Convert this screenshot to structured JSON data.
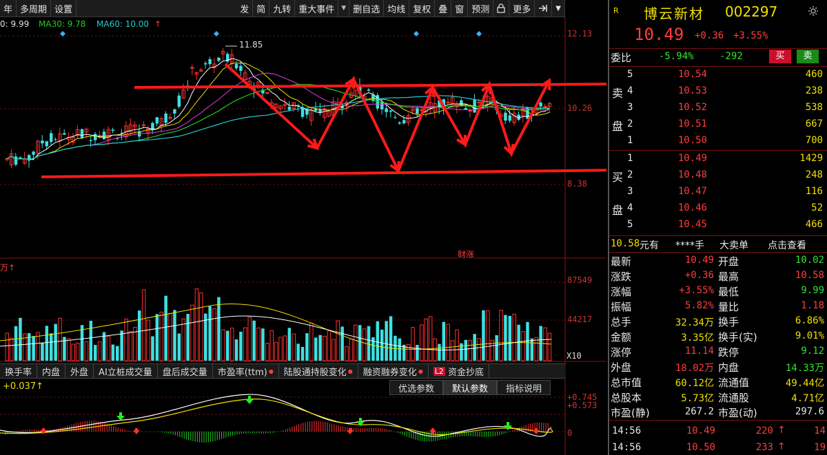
{
  "toolbar": {
    "left_items": [
      "年",
      "多周期",
      "设置"
    ],
    "right_items": [
      {
        "label": "发"
      },
      {
        "label": "简"
      },
      {
        "label": "九转"
      },
      {
        "label": "重大事件",
        "dropdown": true
      },
      {
        "label": "删自选"
      },
      {
        "label": "均线"
      },
      {
        "label": "复权"
      },
      {
        "label": "叠"
      },
      {
        "label": "窗"
      },
      {
        "label": "预测"
      },
      {
        "icon": "lock-icon"
      },
      {
        "label": "更多"
      },
      {
        "icon": "exit-icon"
      },
      {
        "icon": "chevron-down-icon"
      }
    ]
  },
  "legend": {
    "ma_a": "0: 9.99",
    "ma30": "MA30: 9.78",
    "ma60": "MA60: 10.00",
    "ma60_arrow": "↑",
    "vol_unit": "万↑",
    "macd_value": "+0.037↑",
    "colors": {
      "ma_a": "#e0e0e0",
      "ma30": "#22cc22",
      "ma60": "#22cccc"
    }
  },
  "price_axis": {
    "top": "12.13",
    "mid": "10.26",
    "low": "8.38"
  },
  "volume_axis": {
    "top": "87549",
    "mid": "44217",
    "unit": "X10"
  },
  "macd_axis": {
    "top": "+0.745",
    "mid": "+0.573",
    "zero": "0"
  },
  "annotations": {
    "high_label": "11.85",
    "caizhang": "财涨"
  },
  "indicator_tabs": [
    "换手率",
    "内盘",
    "外盘",
    "AI立桩成交量",
    "盘后成交量",
    "市盈率(ttm)",
    "陆股通持股变化",
    "融资融券变化",
    "资金抄底"
  ],
  "l2_badge": "L2",
  "param_tabs": [
    "优选参数",
    "默认参数",
    "指标说明"
  ],
  "stock": {
    "flag": "R",
    "name": "博云新材",
    "code": "002297",
    "price": "10.49",
    "change": "+0.36",
    "change_pct": "+3.55%"
  },
  "order_ratio": {
    "label": "委比",
    "pct": "-5.94%",
    "diff": "-292",
    "buy_btn": "买",
    "sell_btn": "卖"
  },
  "sell_label": [
    "卖",
    "盘"
  ],
  "buy_label": [
    "买",
    "盘"
  ],
  "sell_levels": [
    {
      "level": "5",
      "price": "10.54",
      "vol": "460"
    },
    {
      "level": "4",
      "price": "10.53",
      "vol": "238"
    },
    {
      "level": "3",
      "price": "10.52",
      "vol": "538"
    },
    {
      "level": "2",
      "price": "10.51",
      "vol": "667"
    },
    {
      "level": "1",
      "price": "10.50",
      "vol": "700"
    }
  ],
  "buy_levels": [
    {
      "level": "1",
      "price": "10.49",
      "vol": "1429"
    },
    {
      "level": "2",
      "price": "10.48",
      "vol": "248"
    },
    {
      "level": "3",
      "price": "10.47",
      "vol": "116"
    },
    {
      "level": "4",
      "price": "10.46",
      "vol": "52"
    },
    {
      "level": "5",
      "price": "10.45",
      "vol": "466"
    }
  ],
  "big_order": {
    "price": "10.58",
    "unit": "元有",
    "hand": "****手",
    "label": "大卖单",
    "link": "点击查看"
  },
  "fundamentals": [
    {
      "l": "最新",
      "lv": "10.49",
      "lc": "red",
      "r": "开盘",
      "rv": "10.02",
      "rc": "green"
    },
    {
      "l": "涨跌",
      "lv": "+0.36",
      "lc": "red",
      "r": "最高",
      "rv": "10.58",
      "rc": "red"
    },
    {
      "l": "涨幅",
      "lv": "+3.55%",
      "lc": "red",
      "r": "最低",
      "rv": "9.99",
      "rc": "green"
    },
    {
      "l": "振幅",
      "lv": "5.82%",
      "lc": "red",
      "r": "量比",
      "rv": "1.18",
      "rc": "red"
    },
    {
      "l": "总手",
      "lv": "32.34万",
      "lc": "yellow",
      "r": "换手",
      "rv": "6.86%",
      "rc": "yellow"
    },
    {
      "l": "金额",
      "lv": "3.35亿",
      "lc": "yellow",
      "r": "换手(实)",
      "rv": "9.01%",
      "rc": "yellow"
    },
    {
      "l": "涨停",
      "lv": "11.14",
      "lc": "red",
      "r": "跌停",
      "rv": "9.12",
      "rc": "green"
    },
    {
      "l": "外盘",
      "lv": "18.02万",
      "lc": "red",
      "r": "内盘",
      "rv": "14.33万",
      "rc": "green"
    },
    {
      "l": "总市值",
      "lv": "60.12亿",
      "lc": "yellow",
      "r": "流通值",
      "rv": "49.44亿",
      "rc": "yellow"
    },
    {
      "l": "总股本",
      "lv": "5.73亿",
      "lc": "yellow",
      "r": "流通股",
      "rv": "4.71亿",
      "rc": "yellow"
    },
    {
      "l": "市盈(静)",
      "lv": "267.2",
      "lc": "white",
      "r": "市盈(动)",
      "rv": "297.6",
      "rc": "white"
    }
  ],
  "ticks": [
    {
      "time": "14:56",
      "price": "10.49",
      "vol": "220",
      "count": "14"
    },
    {
      "time": "14:56",
      "price": "10.50",
      "vol": "233",
      "count": "19"
    }
  ]
}
